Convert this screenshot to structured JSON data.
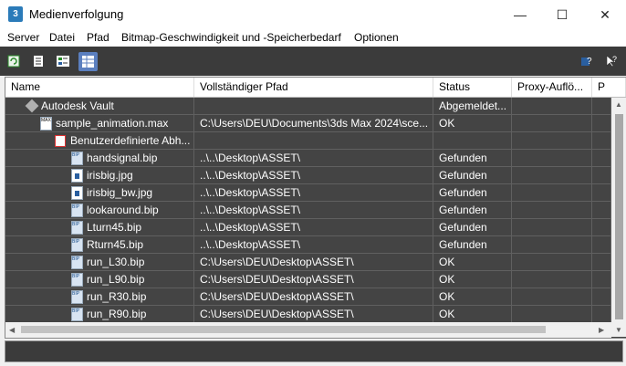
{
  "window": {
    "title": "Medienverfolgung",
    "app_icon_label": "3",
    "controls": {
      "minimize": "—",
      "maximize": "☐",
      "close": "✕"
    }
  },
  "menu": [
    {
      "label": "Server"
    },
    {
      "label": "Datei"
    },
    {
      "label": "Pfad"
    },
    {
      "label": "Bitmap-Geschwindigkeit und -Speicherbedarf"
    },
    {
      "label": "Optionen"
    }
  ],
  "toolbar": {
    "buttons": [
      {
        "icon": "refresh-icon"
      },
      {
        "icon": "list-view-icon"
      },
      {
        "icon": "thumbnail-view-icon"
      },
      {
        "icon": "table-view-icon",
        "active": true
      }
    ],
    "right_buttons": [
      {
        "icon": "help-icon"
      },
      {
        "icon": "context-help-icon"
      }
    ]
  },
  "table": {
    "columns": [
      "Name",
      "Vollständiger Pfad",
      "Status",
      "Proxy-Auflö...",
      "P"
    ],
    "rows": [
      {
        "name": "Autodesk Vault",
        "path": "",
        "status": "Abgemeldet...",
        "proxy": "",
        "icon": "vault-icon",
        "indent": 0
      },
      {
        "name": "sample_animation.max",
        "path": "C:\\Users\\DEU\\Documents\\3ds Max 2024\\sce...",
        "status": "OK",
        "proxy": "",
        "icon": "max-file-icon",
        "indent": 1
      },
      {
        "name": "Benutzerdefinierte Abh...",
        "path": "",
        "status": "",
        "proxy": "",
        "icon": "dependency-tree-icon",
        "indent": 2
      },
      {
        "name": "handsignal.bip",
        "path": "..\\..\\Desktop\\ASSET\\",
        "status": "Gefunden",
        "proxy": "",
        "icon": "bip-file-icon",
        "indent": 3
      },
      {
        "name": "irisbig.jpg",
        "path": "..\\..\\Desktop\\ASSET\\",
        "status": "Gefunden",
        "proxy": "",
        "icon": "jpg-file-icon",
        "indent": 3
      },
      {
        "name": "irisbig_bw.jpg",
        "path": "..\\..\\Desktop\\ASSET\\",
        "status": "Gefunden",
        "proxy": "",
        "icon": "jpg-file-icon",
        "indent": 3
      },
      {
        "name": "lookaround.bip",
        "path": "..\\..\\Desktop\\ASSET\\",
        "status": "Gefunden",
        "proxy": "",
        "icon": "bip-file-icon",
        "indent": 3
      },
      {
        "name": "Lturn45.bip",
        "path": "..\\..\\Desktop\\ASSET\\",
        "status": "Gefunden",
        "proxy": "",
        "icon": "bip-file-icon",
        "indent": 3
      },
      {
        "name": "Rturn45.bip",
        "path": "..\\..\\Desktop\\ASSET\\",
        "status": "Gefunden",
        "proxy": "",
        "icon": "bip-file-icon",
        "indent": 3
      },
      {
        "name": "run_L30.bip",
        "path": "C:\\Users\\DEU\\Desktop\\ASSET\\",
        "status": "OK",
        "proxy": "",
        "icon": "bip-file-icon",
        "indent": 3
      },
      {
        "name": "run_L90.bip",
        "path": "C:\\Users\\DEU\\Desktop\\ASSET\\",
        "status": "OK",
        "proxy": "",
        "icon": "bip-file-icon",
        "indent": 3
      },
      {
        "name": "run_R30.bip",
        "path": "C:\\Users\\DEU\\Desktop\\ASSET\\",
        "status": "OK",
        "proxy": "",
        "icon": "bip-file-icon",
        "indent": 3
      },
      {
        "name": "run_R90.bip",
        "path": "C:\\Users\\DEU\\Desktop\\ASSET\\",
        "status": "OK",
        "proxy": "",
        "icon": "bip-file-icon",
        "indent": 3
      }
    ]
  },
  "scrollbar_arrows": {
    "up": "▲",
    "down": "▼",
    "left": "◀",
    "right": "▶"
  },
  "statusbar": {
    "text": ""
  }
}
